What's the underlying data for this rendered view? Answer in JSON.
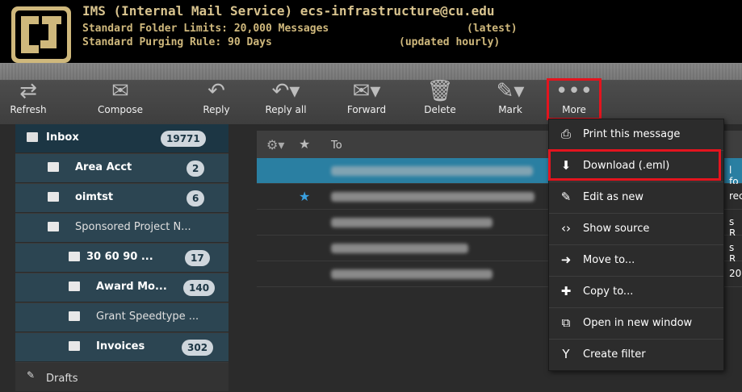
{
  "header": {
    "line1": "IMS (Internal Mail Service) ecs-infrastructure@cu.edu",
    "line2": "Standard Folder Limits: 20,000 Messages",
    "line2_tag": "(latest)",
    "line3": "Standard Purging Rule: 90 Days",
    "line3_tag": "(updated hourly)"
  },
  "toolbar": {
    "buttons": [
      {
        "label": "Refresh",
        "icon": "refresh-icon"
      },
      {
        "label": "Compose",
        "icon": "compose-icon"
      },
      {
        "label": "Reply",
        "icon": "reply-icon"
      },
      {
        "label": "Reply all",
        "icon": "reply-all-icon"
      },
      {
        "label": "Forward",
        "icon": "forward-icon"
      },
      {
        "label": "Delete",
        "icon": "trash-icon"
      },
      {
        "label": "Mark",
        "icon": "mark-icon"
      },
      {
        "label": "More",
        "icon": "more-icon"
      }
    ]
  },
  "folders": [
    {
      "label": "Inbox",
      "count": "19771"
    },
    {
      "label": "Area Acct",
      "count": "2"
    },
    {
      "label": "oimtst",
      "count": "6"
    },
    {
      "label": "Sponsored Project N...",
      "count": ""
    },
    {
      "label": "30 60 90 ...",
      "count": "17"
    },
    {
      "label": "Award Mo...",
      "count": "140"
    },
    {
      "label": "Grant Speedtype ...",
      "count": ""
    },
    {
      "label": "Invoices",
      "count": "302"
    },
    {
      "label": "Drafts",
      "count": ""
    }
  ],
  "list": {
    "column_to": "To",
    "row_tails": [
      "l fo",
      "rec",
      "s R",
      "s R",
      "20"
    ]
  },
  "menu": {
    "items": [
      {
        "label": "Print this message",
        "icon": "printer-icon"
      },
      {
        "label": "Download (.eml)",
        "icon": "download-icon"
      },
      {
        "label": "Edit as new",
        "icon": "edit-icon"
      },
      {
        "label": "Show source",
        "icon": "code-icon"
      },
      {
        "label": "Move to...",
        "icon": "move-icon"
      },
      {
        "label": "Copy to...",
        "icon": "copy-icon"
      },
      {
        "label": "Open in new window",
        "icon": "new-window-icon"
      },
      {
        "label": "Create filter",
        "icon": "filter-icon"
      }
    ]
  },
  "colors": {
    "header_text": "#cfb87c",
    "highlight_box": "#e4141e",
    "selected_row": "#2a7fa2",
    "folder_bg": "#2c4552"
  }
}
